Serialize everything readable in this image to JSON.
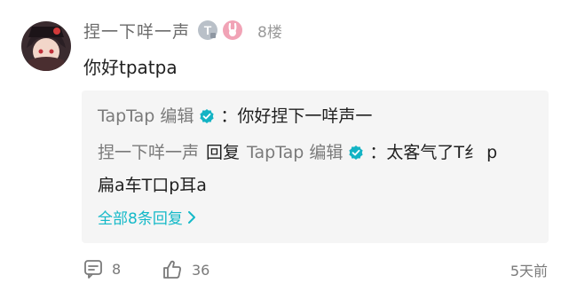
{
  "comment": {
    "username": "捏一下咩一声",
    "floor": "8楼",
    "content": "你好tpatpa",
    "replies": [
      {
        "author": "TapTap 编辑",
        "separator": "：",
        "text": "你好捏下一咩声一"
      },
      {
        "author": "捏一下咩一声",
        "reply_word": "回复",
        "target": "TapTap 编辑",
        "separator": "：",
        "text_line1": "太客气了T纟 p",
        "text_line2": "扁a车T口p耳a"
      }
    ],
    "more_replies": "全部8条回复",
    "comment_count": "8",
    "like_count": "36",
    "time": "5天前"
  },
  "colors": {
    "accent": "#14b9c8",
    "reply_bg": "#f5f5f5",
    "verified": "#13b3c4"
  },
  "icons": {
    "badge_1": "t-level-badge-icon",
    "badge_2": "pink-bunny-badge-icon",
    "verified": "verified-check-icon",
    "comment": "comment-icon",
    "like": "thumbs-up-icon",
    "chevron": "chevron-right-icon"
  }
}
